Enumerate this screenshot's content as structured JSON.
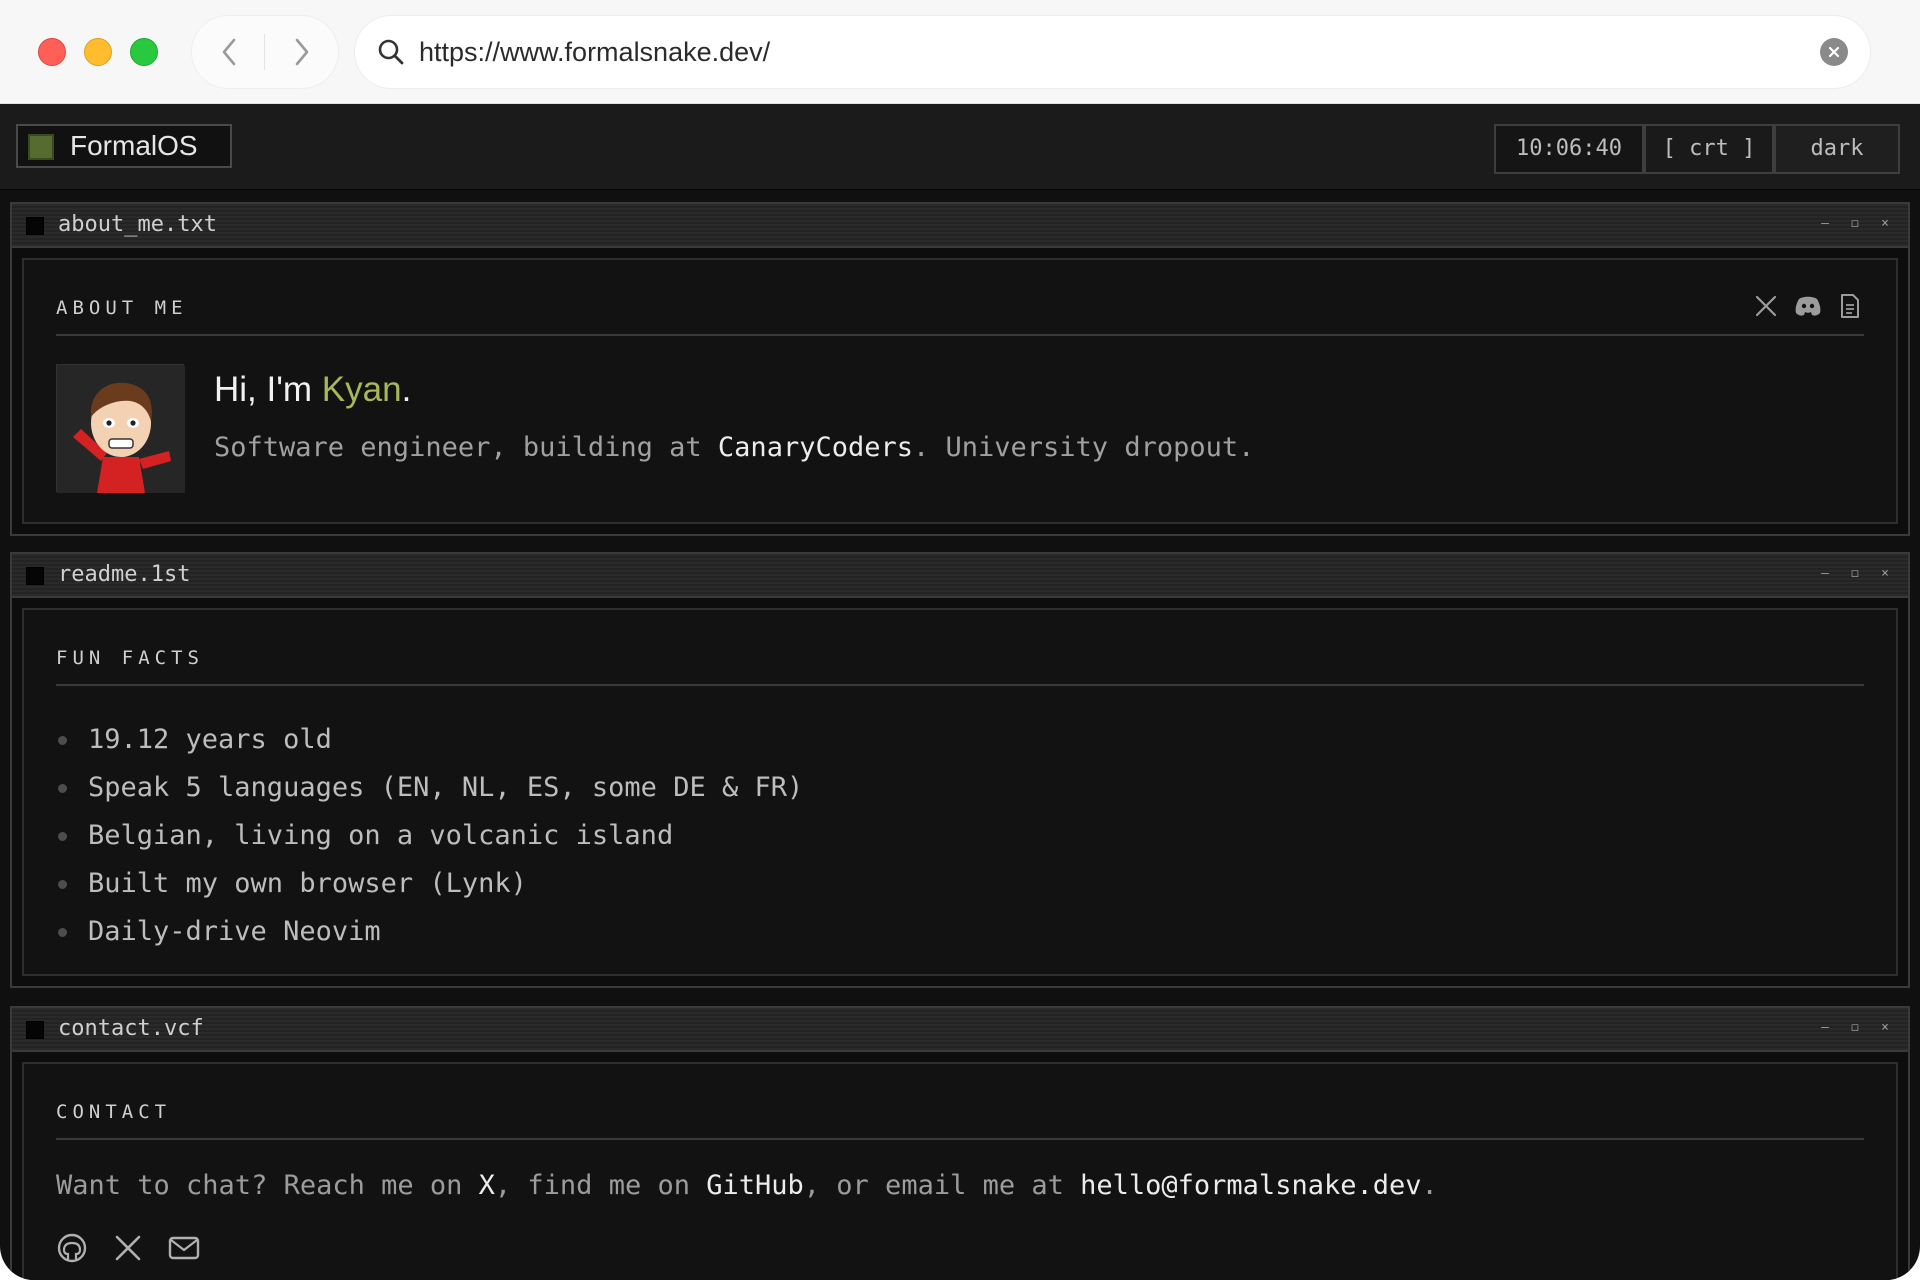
{
  "browser": {
    "url": "https://www.formalsnake.dev/"
  },
  "taskbar": {
    "brand": "FormalOS",
    "clock": "10:06:40",
    "crt_label": "[ crt ]",
    "theme_label": "dark"
  },
  "windows": {
    "about": {
      "filename": "about_me.txt",
      "section_title": "ABOUT ME",
      "greeting_prefix": "Hi, I'm ",
      "name": "Kyan",
      "greeting_suffix": ".",
      "bio_prefix": "Software engineer, building at ",
      "company": "CanaryCoders",
      "bio_suffix": ". University dropout.",
      "social_icons": [
        "x-icon",
        "discord-icon",
        "document-icon"
      ]
    },
    "readme": {
      "filename": "readme.1st",
      "section_title": "FUN FACTS",
      "facts": [
        "19.12 years old",
        "Speak 5 languages (EN, NL, ES, some DE & FR)",
        "Belgian, living on a volcanic island",
        "Built my own browser (Lynk)",
        "Daily-drive Neovim"
      ]
    },
    "contact": {
      "filename": "contact.vcf",
      "section_title": "CONTACT",
      "text_1": "Want to chat? Reach me on ",
      "link_x": "X",
      "text_2": ", find me on ",
      "link_github": "GitHub",
      "text_3": ", or email me at ",
      "link_email": "hello@formalsnake.dev",
      "text_4": ".",
      "icons": [
        "github-icon",
        "x-icon",
        "mail-icon"
      ]
    },
    "controls": {
      "min": "–",
      "max": "◻",
      "close": "×"
    }
  },
  "colors": {
    "accent": "#a6b85a",
    "background": "#121212",
    "text_dim": "#a0a0a0",
    "text_bright": "#ececec"
  }
}
